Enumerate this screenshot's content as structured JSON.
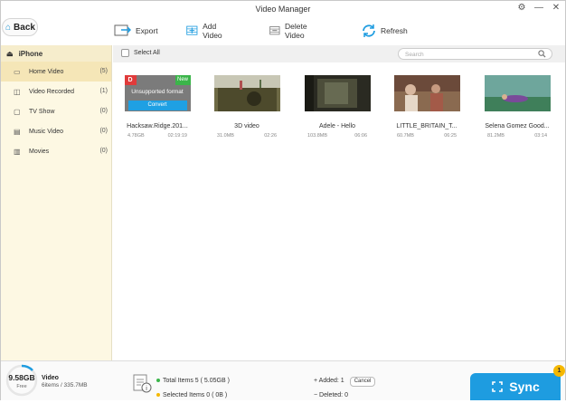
{
  "window": {
    "title": "Video Manager"
  },
  "back": {
    "label": "Back"
  },
  "toolbar": {
    "items": [
      {
        "label": "Export",
        "icon": "export-icon"
      },
      {
        "label": "Add Video",
        "icon": "add-video-icon"
      },
      {
        "label": "Delete Video",
        "icon": "delete-video-icon"
      },
      {
        "label": "Refresh",
        "icon": "refresh-icon"
      }
    ]
  },
  "sidebar": {
    "device": "iPhone",
    "items": [
      {
        "label": "Home Video",
        "count": "(5)",
        "icon": "home-video-icon",
        "active": true
      },
      {
        "label": "Video Recorded",
        "count": "(1)",
        "icon": "video-recorded-icon"
      },
      {
        "label": "TV Show",
        "count": "(0)",
        "icon": "tv-icon"
      },
      {
        "label": "Music Video",
        "count": "(0)",
        "icon": "music-video-icon"
      },
      {
        "label": "Movies",
        "count": "(0)",
        "icon": "movies-icon"
      }
    ]
  },
  "content": {
    "select_all": "Select All",
    "search_placeholder": "Search",
    "unsupported": {
      "title": "Unsupported format",
      "convert": "Convert",
      "new_badge": "New",
      "red_badge": "D"
    },
    "videos": [
      {
        "name": "Hacksaw.Ridge.201...",
        "size": "4.78GB",
        "duration": "02:19:19"
      },
      {
        "name": "3D video",
        "size": "31.0MB",
        "duration": "02:26"
      },
      {
        "name": "Adele - Hello",
        "size": "103.8MB",
        "duration": "06:06"
      },
      {
        "name": "LITTLE_BRITAIN_T...",
        "size": "60.7MB",
        "duration": "06:25"
      },
      {
        "name": "Selena Gomez Good...",
        "size": "81.2MB",
        "duration": "03:14"
      }
    ]
  },
  "bottom": {
    "free_size": "9.58GB",
    "free_label": "Free",
    "category": "Video",
    "usage": "6items / 335.7MB",
    "total_items": "Total Items 5 ( 5.05GB )",
    "selected_items": "Selected Items 0 ( 0B )",
    "added": "Added: 1",
    "deleted": "Deleted: 0",
    "cancel": "Cancel",
    "sync": "Sync",
    "sync_badge": "1"
  },
  "colors": {
    "accent": "#1e9ce0",
    "total_dot": "#3bb54a",
    "selected_dot": "#f5b800",
    "sidebar_bg": "#fdf8e3"
  }
}
